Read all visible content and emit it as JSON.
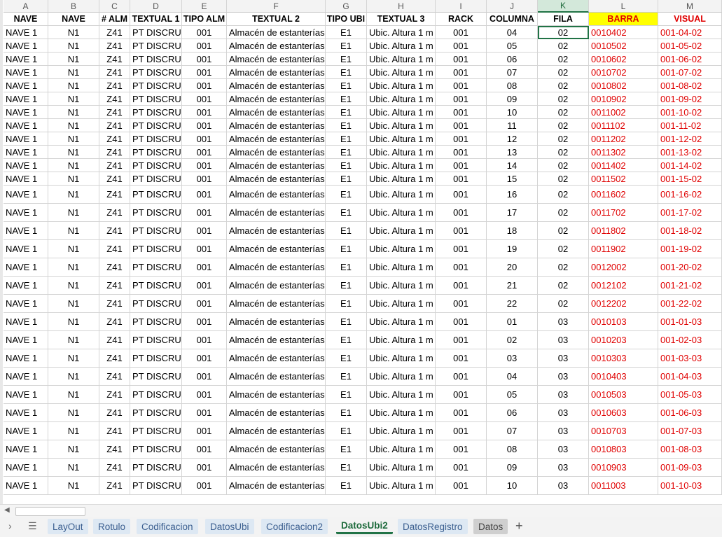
{
  "sheet": {
    "column_letters": [
      "A",
      "B",
      "C",
      "D",
      "E",
      "F",
      "G",
      "H",
      "I",
      "J",
      "K",
      "L",
      "M"
    ],
    "selected_column": "K",
    "headers": [
      "NAVE",
      "NAVE",
      "# ALM",
      "TEXTUAL 1",
      "TIPO ALM",
      "TEXTUAL 2",
      "TIPO UBI",
      "TEXTUAL 3",
      "RACK",
      "COLUMNA",
      "FILA",
      "BARRA",
      "VISUAL"
    ],
    "rows": [
      [
        "NAVE 1",
        "N1",
        "Z41",
        "PT DISCRUZ",
        "001",
        "Almacén de estanterías",
        "E1",
        "Ubic. Altura 1 m",
        "001",
        "04",
        "02",
        "0010402",
        "001-04-02"
      ],
      [
        "NAVE 1",
        "N1",
        "Z41",
        "PT DISCRUZ",
        "001",
        "Almacén de estanterías",
        "E1",
        "Ubic. Altura 1 m",
        "001",
        "05",
        "02",
        "0010502",
        "001-05-02"
      ],
      [
        "NAVE 1",
        "N1",
        "Z41",
        "PT DISCRUZ",
        "001",
        "Almacén de estanterías",
        "E1",
        "Ubic. Altura 1 m",
        "001",
        "06",
        "02",
        "0010602",
        "001-06-02"
      ],
      [
        "NAVE 1",
        "N1",
        "Z41",
        "PT DISCRUZ",
        "001",
        "Almacén de estanterías",
        "E1",
        "Ubic. Altura 1 m",
        "001",
        "07",
        "02",
        "0010702",
        "001-07-02"
      ],
      [
        "NAVE 1",
        "N1",
        "Z41",
        "PT DISCRUZ",
        "001",
        "Almacén de estanterías",
        "E1",
        "Ubic. Altura 1 m",
        "001",
        "08",
        "02",
        "0010802",
        "001-08-02"
      ],
      [
        "NAVE 1",
        "N1",
        "Z41",
        "PT DISCRUZ",
        "001",
        "Almacén de estanterías",
        "E1",
        "Ubic. Altura 1 m",
        "001",
        "09",
        "02",
        "0010902",
        "001-09-02"
      ],
      [
        "NAVE 1",
        "N1",
        "Z41",
        "PT DISCRUZ",
        "001",
        "Almacén de estanterías",
        "E1",
        "Ubic. Altura 1 m",
        "001",
        "10",
        "02",
        "0011002",
        "001-10-02"
      ],
      [
        "NAVE 1",
        "N1",
        "Z41",
        "PT DISCRUZ",
        "001",
        "Almacén de estanterías",
        "E1",
        "Ubic. Altura 1 m",
        "001",
        "11",
        "02",
        "0011102",
        "001-11-02"
      ],
      [
        "NAVE 1",
        "N1",
        "Z41",
        "PT DISCRUZ",
        "001",
        "Almacén de estanterías",
        "E1",
        "Ubic. Altura 1 m",
        "001",
        "12",
        "02",
        "0011202",
        "001-12-02"
      ],
      [
        "NAVE 1",
        "N1",
        "Z41",
        "PT DISCRUZ",
        "001",
        "Almacén de estanterías",
        "E1",
        "Ubic. Altura 1 m",
        "001",
        "13",
        "02",
        "0011302",
        "001-13-02"
      ],
      [
        "NAVE 1",
        "N1",
        "Z41",
        "PT DISCRUZ",
        "001",
        "Almacén de estanterías",
        "E1",
        "Ubic. Altura 1 m",
        "001",
        "14",
        "02",
        "0011402",
        "001-14-02"
      ],
      [
        "NAVE 1",
        "N1",
        "Z41",
        "PT DISCRUZ",
        "001",
        "Almacén de estanterías",
        "E1",
        "Ubic. Altura 1 m",
        "001",
        "15",
        "02",
        "0011502",
        "001-15-02"
      ],
      [
        "NAVE 1",
        "N1",
        "Z41",
        "PT DISCRUZ",
        "001",
        "Almacén de estanterías",
        "E1",
        "Ubic. Altura 1 m",
        "001",
        "16",
        "02",
        "0011602",
        "001-16-02"
      ],
      [
        "NAVE 1",
        "N1",
        "Z41",
        "PT DISCRUZ",
        "001",
        "Almacén de estanterías",
        "E1",
        "Ubic. Altura 1 m",
        "001",
        "17",
        "02",
        "0011702",
        "001-17-02"
      ],
      [
        "NAVE 1",
        "N1",
        "Z41",
        "PT DISCRUZ",
        "001",
        "Almacén de estanterías",
        "E1",
        "Ubic. Altura 1 m",
        "001",
        "18",
        "02",
        "0011802",
        "001-18-02"
      ],
      [
        "NAVE 1",
        "N1",
        "Z41",
        "PT DISCRUZ",
        "001",
        "Almacén de estanterías",
        "E1",
        "Ubic. Altura 1 m",
        "001",
        "19",
        "02",
        "0011902",
        "001-19-02"
      ],
      [
        "NAVE 1",
        "N1",
        "Z41",
        "PT DISCRUZ",
        "001",
        "Almacén de estanterías",
        "E1",
        "Ubic. Altura 1 m",
        "001",
        "20",
        "02",
        "0012002",
        "001-20-02"
      ],
      [
        "NAVE 1",
        "N1",
        "Z41",
        "PT DISCRUZ",
        "001",
        "Almacén de estanterías",
        "E1",
        "Ubic. Altura 1 m",
        "001",
        "21",
        "02",
        "0012102",
        "001-21-02"
      ],
      [
        "NAVE 1",
        "N1",
        "Z41",
        "PT DISCRUZ",
        "001",
        "Almacén de estanterías",
        "E1",
        "Ubic. Altura 1 m",
        "001",
        "22",
        "02",
        "0012202",
        "001-22-02"
      ],
      [
        "NAVE 1",
        "N1",
        "Z41",
        "PT DISCRUZ",
        "001",
        "Almacén de estanterías",
        "E1",
        "Ubic. Altura 1 m",
        "001",
        "01",
        "03",
        "0010103",
        "001-01-03"
      ],
      [
        "NAVE 1",
        "N1",
        "Z41",
        "PT DISCRUZ",
        "001",
        "Almacén de estanterías",
        "E1",
        "Ubic. Altura 1 m",
        "001",
        "02",
        "03",
        "0010203",
        "001-02-03"
      ],
      [
        "NAVE 1",
        "N1",
        "Z41",
        "PT DISCRUZ",
        "001",
        "Almacén de estanterías",
        "E1",
        "Ubic. Altura 1 m",
        "001",
        "03",
        "03",
        "0010303",
        "001-03-03"
      ],
      [
        "NAVE 1",
        "N1",
        "Z41",
        "PT DISCRUZ",
        "001",
        "Almacén de estanterías",
        "E1",
        "Ubic. Altura 1 m",
        "001",
        "04",
        "03",
        "0010403",
        "001-04-03"
      ],
      [
        "NAVE 1",
        "N1",
        "Z41",
        "PT DISCRUZ",
        "001",
        "Almacén de estanterías",
        "E1",
        "Ubic. Altura 1 m",
        "001",
        "05",
        "03",
        "0010503",
        "001-05-03"
      ],
      [
        "NAVE 1",
        "N1",
        "Z41",
        "PT DISCRUZ",
        "001",
        "Almacén de estanterías",
        "E1",
        "Ubic. Altura 1 m",
        "001",
        "06",
        "03",
        "0010603",
        "001-06-03"
      ],
      [
        "NAVE 1",
        "N1",
        "Z41",
        "PT DISCRUZ",
        "001",
        "Almacén de estanterías",
        "E1",
        "Ubic. Altura 1 m",
        "001",
        "07",
        "03",
        "0010703",
        "001-07-03"
      ],
      [
        "NAVE 1",
        "N1",
        "Z41",
        "PT DISCRUZ",
        "001",
        "Almacén de estanterías",
        "E1",
        "Ubic. Altura 1 m",
        "001",
        "08",
        "03",
        "0010803",
        "001-08-03"
      ],
      [
        "NAVE 1",
        "N1",
        "Z41",
        "PT DISCRUZ",
        "001",
        "Almacén de estanterías",
        "E1",
        "Ubic. Altura 1 m",
        "001",
        "09",
        "03",
        "0010903",
        "001-09-03"
      ],
      [
        "NAVE 1",
        "N1",
        "Z41",
        "PT DISCRUZ",
        "001",
        "Almacén de estanterías",
        "E1",
        "Ubic. Altura 1 m",
        "001",
        "10",
        "03",
        "0011003",
        "001-10-03"
      ]
    ],
    "colors": {
      "accent": "#217346",
      "barra_header_bg": "#ffff00",
      "red_text": "#e00000"
    }
  },
  "tabs": [
    {
      "label": "LayOut",
      "state": "normal"
    },
    {
      "label": "Rotulo",
      "state": "normal"
    },
    {
      "label": "Codificacion",
      "state": "normal"
    },
    {
      "label": "DatosUbi",
      "state": "normal"
    },
    {
      "label": "Codificacion2",
      "state": "normal"
    },
    {
      "label": "DatosUbi2",
      "state": "active"
    },
    {
      "label": "DatosRegistro",
      "state": "normal"
    },
    {
      "label": "Datos",
      "state": "gray"
    }
  ],
  "icons": {
    "nav_next": "chevron-right-icon",
    "all_sheets": "hamburger-menu-icon",
    "add_sheet": "plus-icon",
    "scroll_left": "triangle-left-icon"
  },
  "glyphs": {
    "nav_next": "›",
    "all_sheets": "☰",
    "add_sheet": "+",
    "scroll_left": "◀"
  }
}
